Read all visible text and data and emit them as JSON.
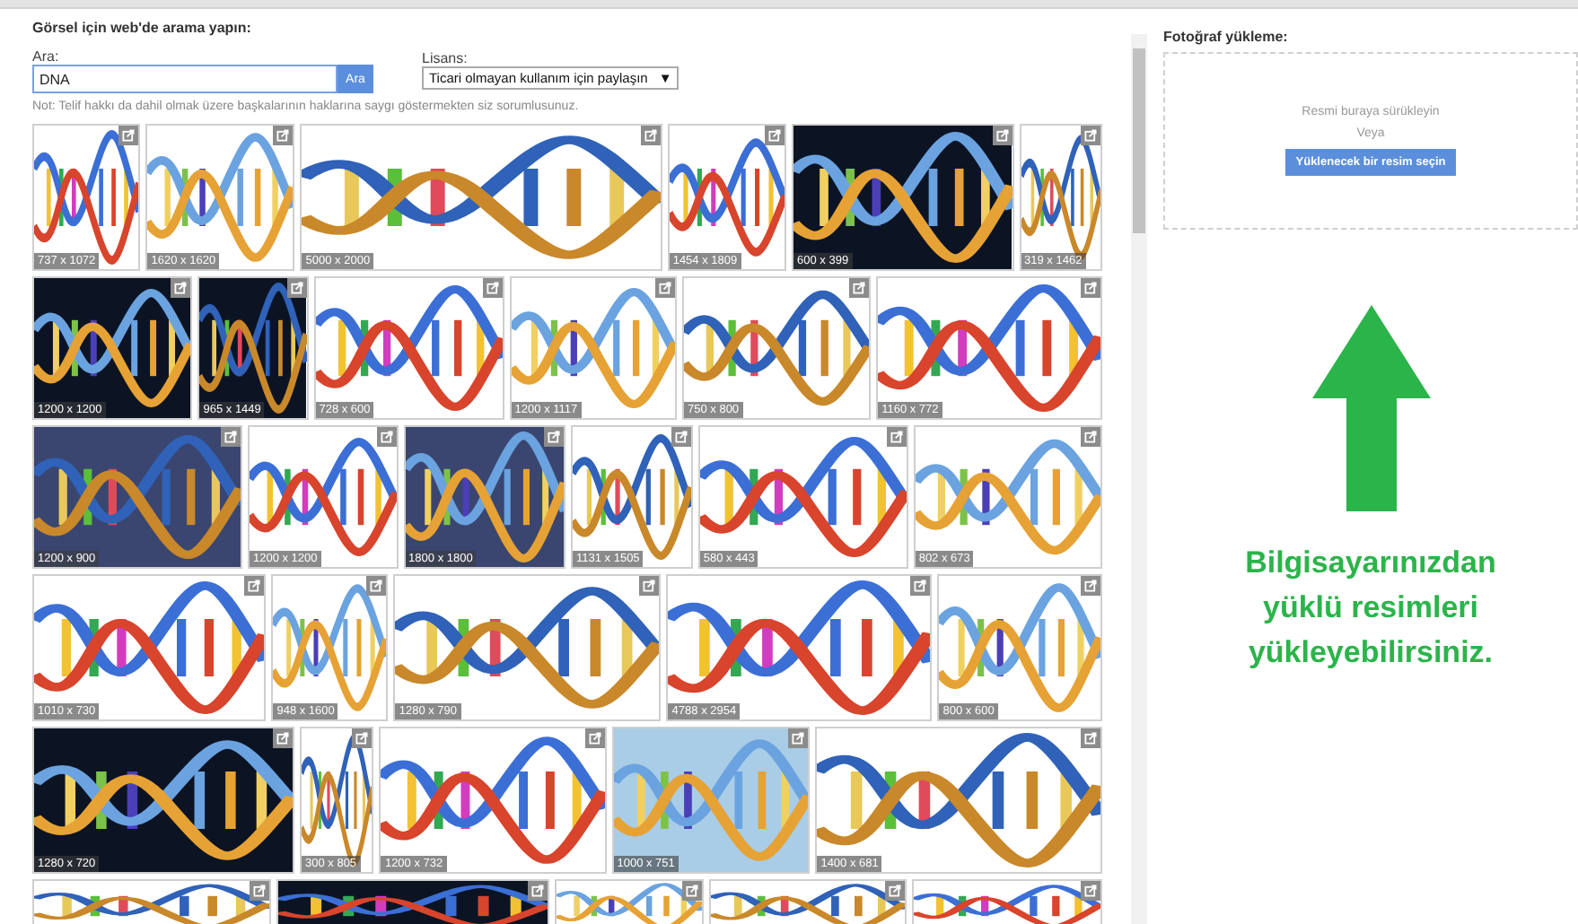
{
  "search": {
    "heading": "Görsel için web'de arama yapın:",
    "label": "Ara:",
    "value": "DNA",
    "button": "Ara"
  },
  "license": {
    "label": "Lisans:",
    "value": "Ticari olmayan kullanım için paylaşın",
    "arrow": "▼"
  },
  "note": "Not: Telif hakkı da dahil olmak üzere başkalarının haklarına saygı göstermekten siz sorumlusunuz.",
  "results": [
    [
      {
        "kind": "picture",
        "size": "737 x 1072"
      },
      {
        "kind": "picture",
        "size": "1620 x 1620"
      },
      {
        "kind": "picture",
        "size": "5000 x 2000"
      },
      {
        "kind": "picture",
        "size": "1454 x 1809"
      },
      {
        "kind": "picture",
        "size": "600 x 399"
      },
      {
        "kind": "picture",
        "size": "319 x 1462"
      }
    ],
    [
      {
        "kind": "picture",
        "size": "1200 x 1200"
      },
      {
        "kind": "picture",
        "size": "965 x 1449"
      },
      {
        "kind": "picture",
        "size": "728 x 600"
      },
      {
        "kind": "picture",
        "size": "1200 x 1117"
      },
      {
        "kind": "picture",
        "size": "750 x 800"
      },
      {
        "kind": "picture",
        "size": "1160 x 772"
      }
    ],
    [
      {
        "kind": "picture",
        "size": "1200 x 900"
      },
      {
        "kind": "picture",
        "size": "1200 x 1200"
      },
      {
        "kind": "picture",
        "size": "1800 x 1800"
      },
      {
        "kind": "picture",
        "size": "1131 x 1505"
      },
      {
        "kind": "picture",
        "size": "580 x 443"
      },
      {
        "kind": "picture",
        "size": "802 x 673"
      }
    ],
    [
      {
        "kind": "picture",
        "size": "1010 x 730"
      },
      {
        "kind": "picture",
        "size": "948 x 1600"
      },
      {
        "kind": "picture",
        "size": "1280 x 790"
      },
      {
        "kind": "picture",
        "size": "4788 x 2954"
      },
      {
        "kind": "picture",
        "size": "800 x 600"
      }
    ],
    [
      {
        "kind": "picture",
        "size": "1280 x 720"
      },
      {
        "kind": "picture",
        "size": "300 x 805"
      },
      {
        "kind": "picture",
        "size": "1200 x 732"
      },
      {
        "kind": "picture",
        "size": "1000 x 751"
      },
      {
        "kind": "picture",
        "size": "1400 x 681"
      }
    ],
    [
      {
        "kind": "picture"
      },
      {
        "kind": "picture"
      },
      {
        "kind": "picture"
      },
      {
        "kind": "picture"
      },
      {
        "kind": "picture"
      }
    ]
  ],
  "upload": {
    "title": "Fotoğraf yükleme:",
    "drop_hint": "Resmi buraya sürükleyin",
    "or": "Veya",
    "button": "Yüklenecek bir resim seçin"
  },
  "callout": {
    "lines": [
      "Bilgisayarınızdan",
      "yüklü resimleri",
      "yükleyebilirsiniz."
    ]
  }
}
